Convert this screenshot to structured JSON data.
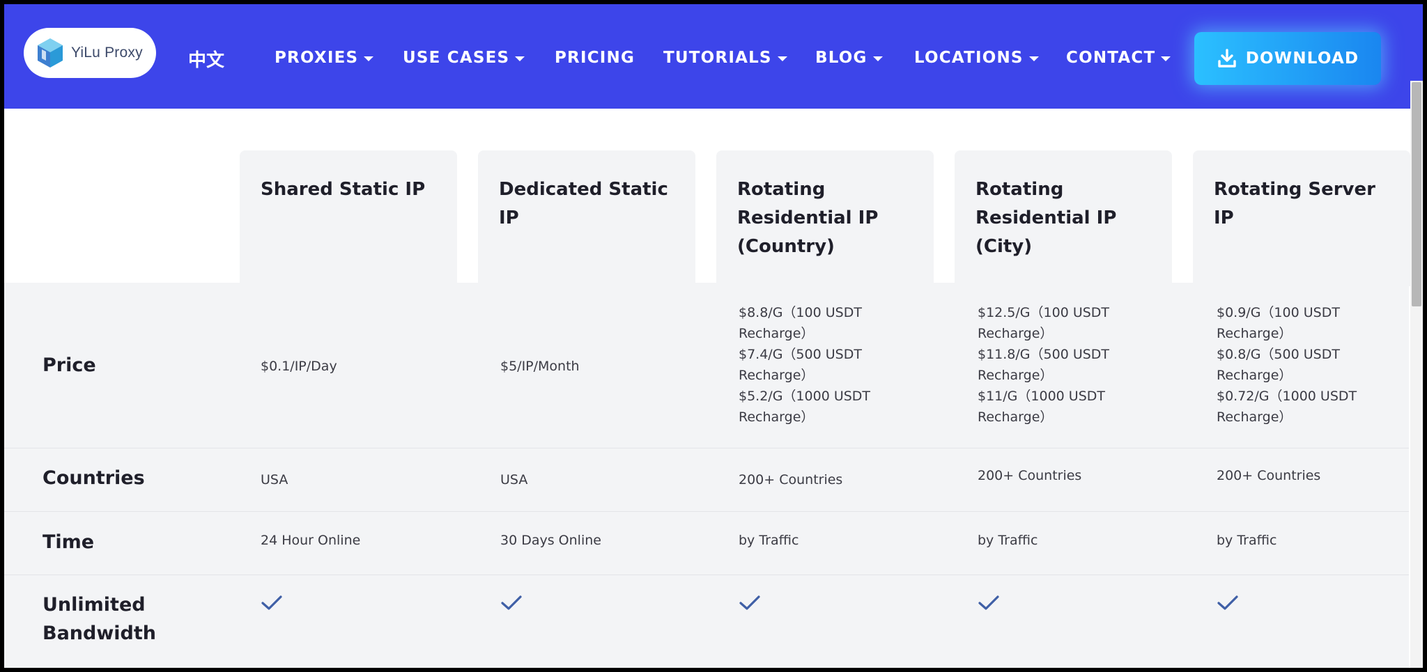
{
  "header": {
    "logo_text": "YiLu Proxy",
    "lang": "中文",
    "nav": [
      {
        "label": "PROXIES",
        "dropdown": true
      },
      {
        "label": "USE CASES",
        "dropdown": true
      },
      {
        "label": "PRICING",
        "dropdown": false
      },
      {
        "label": "TUTORIALS",
        "dropdown": true
      },
      {
        "label": "BLOG",
        "dropdown": true
      },
      {
        "label": "LOCATIONS",
        "dropdown": true
      },
      {
        "label": "CONTACT",
        "dropdown": true
      }
    ],
    "download_label": "DOWNLOAD",
    "download_icon": "download-icon",
    "colors": {
      "nav_bg": "#3d45ea",
      "download_from": "#2bc0ff",
      "download_to": "#1a86f0",
      "check": "#3f5fa6"
    }
  },
  "table": {
    "columns": [
      "Shared Static IP",
      "Dedicated Static IP",
      "Rotating Residential IP (Country)",
      "Rotating Residential IP (City)",
      "Rotating Server IP"
    ],
    "rows": [
      {
        "label": "Price",
        "cells": [
          "$0.1/IP/Day",
          "$5/IP/Month",
          "$8.8/G（100 USDT Recharge）\n$7.4/G（500 USDT Recharge）\n$5.2/G（1000 USDT Recharge）",
          "$12.5/G（100 USDT Recharge）\n$11.8/G（500 USDT Recharge）\n$11/G（1000 USDT Recharge）",
          "$0.9/G（100 USDT Recharge）\n$0.8/G（500 USDT Recharge）\n$0.72/G（1000 USDT Recharge）"
        ]
      },
      {
        "label": "Countries",
        "cells": [
          "USA",
          "USA",
          "200+ Countries",
          "200+ Countries",
          "200+ Countries"
        ]
      },
      {
        "label": "Time",
        "cells": [
          "24 Hour Online",
          "30 Days Online",
          "by Traffic",
          "by Traffic",
          "by Traffic"
        ]
      },
      {
        "label": "Unlimited Bandwidth",
        "cells": [
          true,
          true,
          true,
          true,
          true
        ],
        "icon": "checkmark-icon"
      }
    ]
  }
}
